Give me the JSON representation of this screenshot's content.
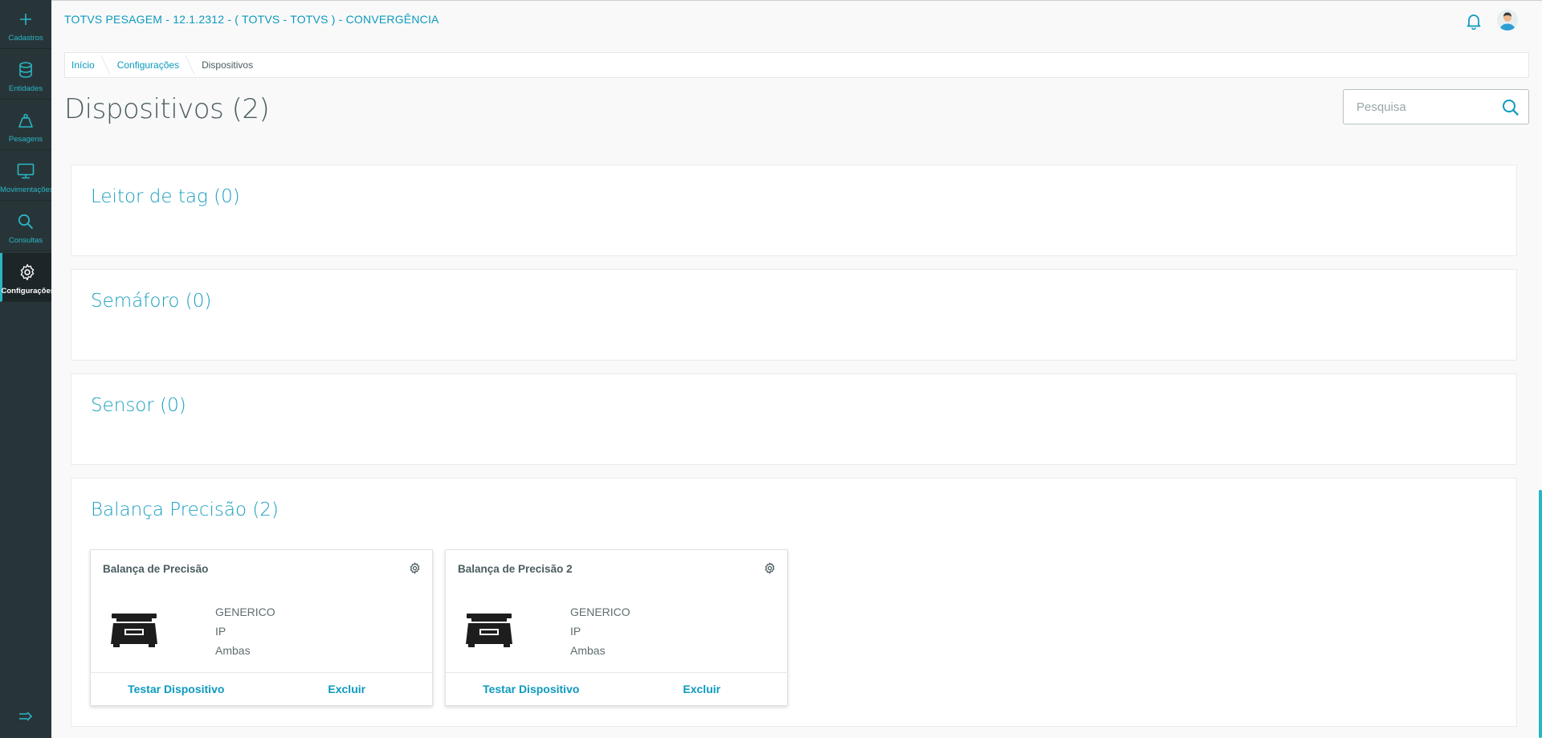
{
  "colors": {
    "accent": "#0c9abe",
    "sidebar": "#283538",
    "sidebar_label": "#29b6c5"
  },
  "sidebar": {
    "items": [
      {
        "label": "Cadastros",
        "icon": "plus-icon"
      },
      {
        "label": "Entidades",
        "icon": "database-icon"
      },
      {
        "label": "Pesagens",
        "icon": "weight-icon"
      },
      {
        "label": "Movimentações",
        "icon": "monitor-icon"
      },
      {
        "label": "Consultas",
        "icon": "search-icon"
      },
      {
        "label": "Configurações",
        "icon": "gear-icon",
        "active": true
      }
    ],
    "collapse_icon": "collapse-menu-icon"
  },
  "header": {
    "title": "TOTVS PESAGEM - 12.1.2312 - ( TOTVS - TOTVS ) - CONVERGÊNCIA",
    "notification_icon": "bell-icon",
    "avatar_icon": "user-avatar-icon"
  },
  "breadcrumb": [
    "Início",
    "Configurações",
    "Dispositivos"
  ],
  "page": {
    "title": "Dispositivos (2)",
    "search_placeholder": "Pesquisa"
  },
  "sections": [
    {
      "title": "Leitor de tag (0)"
    },
    {
      "title": "Semáforo (0)"
    },
    {
      "title": "Sensor (0)"
    },
    {
      "title": "Balança Precisão (2)"
    }
  ],
  "devices": [
    {
      "name": "Balança de Precisão",
      "brand": "GENERICO",
      "connection": "IP",
      "mode": "Ambas",
      "actions": {
        "test": "Testar Dispositivo",
        "delete": "Excluir"
      }
    },
    {
      "name": "Balança de Precisão 2",
      "brand": "GENERICO",
      "connection": "IP",
      "mode": "Ambas",
      "actions": {
        "test": "Testar Dispositivo",
        "delete": "Excluir"
      }
    }
  ]
}
